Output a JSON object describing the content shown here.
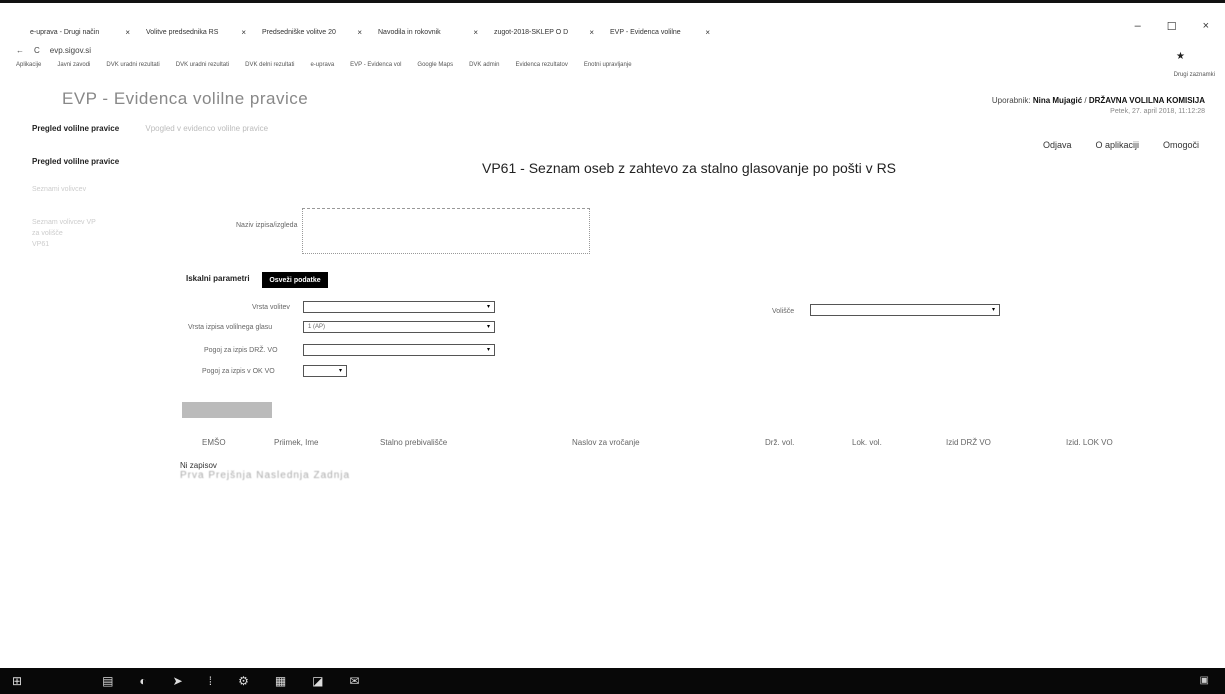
{
  "browser": {
    "tabs": [
      {
        "label": "e-uprava - Drugi način"
      },
      {
        "label": "Volitve predsednika RS"
      },
      {
        "label": "Predsedniške volitve 20"
      },
      {
        "label": "Navodila in rokovnik"
      },
      {
        "label": "zugot-2018-SKLEP O D"
      },
      {
        "label": "EVP - Evidenca volilne"
      }
    ],
    "tab_close": "×",
    "window_controls": {
      "minimize": "–",
      "maximize": "☐",
      "close": "×"
    },
    "address": "evp.sigov.si",
    "back": "←",
    "reload": "C",
    "bookmark_star": "★",
    "bookmarks": [
      "Aplikacije",
      "Javni zavodi",
      "DVK uradni rezultati",
      "DVK uradni rezultati",
      "DVK delni rezultati",
      "e-uprava",
      "EVP - Evidenca vol",
      "Google Maps",
      "DVK admin",
      "Evidenca rezultatov",
      "Enotni upravljanje"
    ],
    "bookmarks_other": "Drugi zaznamki"
  },
  "app": {
    "title": "EVP - Evidenca volilne pravice",
    "user_prefix": "Uporabnik: ",
    "user_name": "Nina Mujagić",
    "separator": " / ",
    "organization": "DRŽAVNA VOLILNA KOMISIJA",
    "datetime": "Petek, 27. april 2018, 11:12:28",
    "nav": {
      "active": "Pregled volilne pravice",
      "dim": "Vpogled v evidenco volilne pravice"
    },
    "top_links": [
      "Odjava",
      "O aplikaciji",
      "Omogoči"
    ],
    "sidebar": {
      "title": "Pregled volilne pravice",
      "items": [
        "Seznami volivcev",
        "Seznam volivcev VP",
        "za volišče",
        "VP61"
      ]
    }
  },
  "page": {
    "title": "VP61 - Seznam oseb z zahtevo za stalno glasovanje po pošti v RS",
    "naziv_label": "Naziv izpisa/izgleda",
    "iskalni_label": "Iskalni parametri",
    "osvezi_button": "Osveži podatke",
    "fields": [
      {
        "label": "Vrsta volitev",
        "value": ""
      },
      {
        "label": "Vrsta izpisa volilnega glasu",
        "value": "1 (AP)"
      },
      {
        "label": "Pogoj za izpis DRŽ. VO",
        "value": ""
      },
      {
        "label": "Pogoj za izpis v OK VO",
        "value": ""
      }
    ],
    "right_field": {
      "label": "Volišče",
      "value": ""
    },
    "select_arrow": "▾",
    "columns": [
      "EMŠO",
      "Priimek, Ime",
      "Stalno prebivališče",
      "Naslov za vročanje",
      "Drž. vol.",
      "Lok. vol.",
      "Izid DRŽ VO",
      "Izid. LOK VO"
    ],
    "no_records": "Ni zapisov",
    "pager": "Prva Prejšnja Naslednja Zadnja"
  },
  "taskbar": {
    "icons": [
      "windows-start",
      "file-explorer",
      "chrome",
      "edge",
      "outlook",
      "settings",
      "excel",
      "word",
      "mail"
    ],
    "glyphs": [
      "⊞",
      "▤",
      "◐",
      "➤",
      "⁞",
      "⚙",
      "▦",
      "◪",
      "✉"
    ],
    "tray": "▣"
  }
}
